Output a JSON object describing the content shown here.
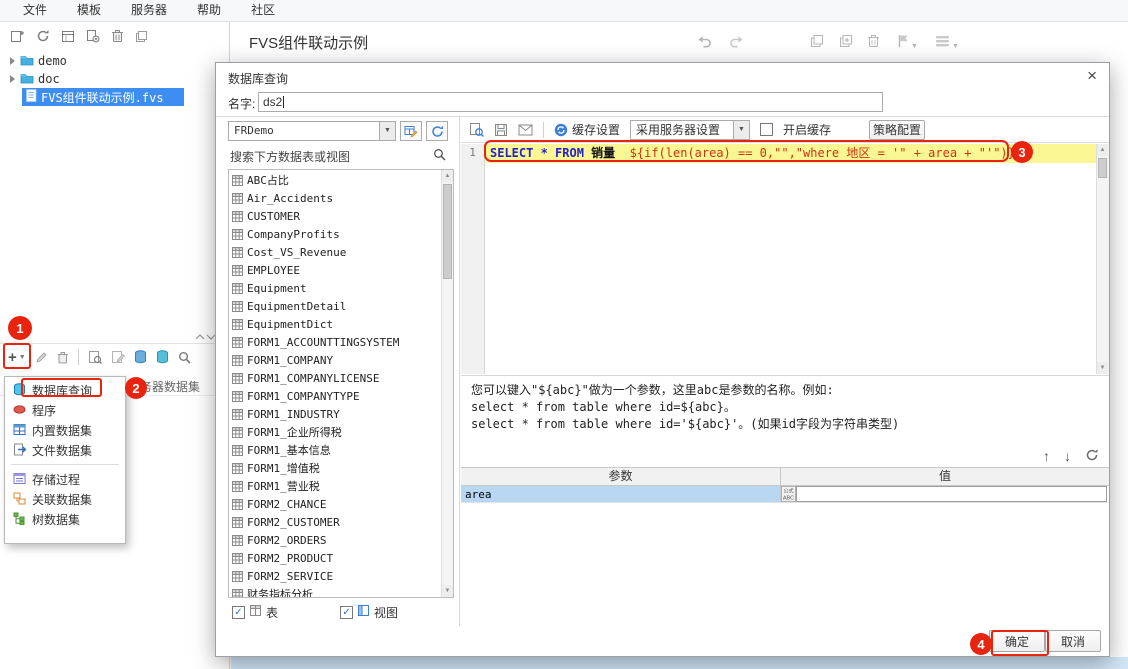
{
  "menubar": {
    "items": [
      "文件",
      "模板",
      "服务器",
      "帮助",
      "社区"
    ]
  },
  "tree": {
    "folders": [
      "demo",
      "doc"
    ],
    "selected_file": "FVS组件联动示例.fvs"
  },
  "doc_header": {
    "title": "FVS组件联动示例"
  },
  "dataset_panel": {
    "server_tab_label": "服务器数据集",
    "menu_group1": [
      {
        "label": "数据库查询",
        "icon": "database"
      },
      {
        "label": "程序",
        "icon": "program"
      },
      {
        "label": "内置数据集",
        "icon": "builtin"
      },
      {
        "label": "文件数据集",
        "icon": "filedataset"
      }
    ],
    "menu_group2": [
      {
        "label": "存储过程",
        "icon": "procedure"
      },
      {
        "label": "关联数据集",
        "icon": "relation"
      },
      {
        "label": "树数据集",
        "icon": "treedataset"
      }
    ]
  },
  "dialog": {
    "title": "数据库查询",
    "name_label": "名字:",
    "name_value": "ds2",
    "connection_value": "FRDemo",
    "search_placeholder": "搜索下方数据表或视图",
    "tables": [
      "ABC占比",
      "Air_Accidents",
      "CUSTOMER",
      "CompanyProfits",
      "Cost_VS_Revenue",
      "EMPLOYEE",
      "Equipment",
      "EquipmentDetail",
      "EquipmentDict",
      "FORM1_ACCOUNTTINGSYSTEM",
      "FORM1_COMPANY",
      "FORM1_COMPANYLICENSE",
      "FORM1_COMPANYTYPE",
      "FORM1_INDUSTRY",
      "FORM1_企业所得税",
      "FORM1_基本信息",
      "FORM1_增值税",
      "FORM1_营业税",
      "FORM2_CHANCE",
      "FORM2_CUSTOMER",
      "FORM2_ORDERS",
      "FORM2_PRODUCT",
      "FORM2_SERVICE",
      "财务指标分析"
    ],
    "table_checkbox_label": "表",
    "view_checkbox_label": "视图",
    "toolbar": {
      "cache_settings_label": "缓存设置",
      "server_setting_value": "采用服务器设置",
      "enable_cache_label": "开启缓存",
      "strategy_config_label": "策略配置"
    },
    "sql": {
      "line_number": "1",
      "segments": [
        {
          "text": "SELECT",
          "color": "#2222cc",
          "bold": true
        },
        {
          "text": " * ",
          "color": "#2222cc",
          "bold": true
        },
        {
          "text": "FROM",
          "color": "#2222cc",
          "bold": true
        },
        {
          "text": " 销量  ",
          "color": "#111111",
          "bold": true
        },
        {
          "text": "${if(len(area) == 0,\"\",\"where 地区 = '\" + area + \"'\")}",
          "color": "#cc3311",
          "bold": false
        }
      ]
    },
    "help_lines": [
      "您可以键入\"${abc}\"做为一个参数，这里abc是参数的名称。例如:",
      "select * from table where id=${abc}。",
      "select * from table where id='${abc}'。(如果id字段为字符串类型)"
    ],
    "params": {
      "headers": [
        "参数",
        "值"
      ],
      "rows": [
        {
          "name": "area",
          "value": ""
        }
      ]
    },
    "ok_label": "确定",
    "cancel_label": "取消"
  },
  "annotations": {
    "step1": "1",
    "step2": "2",
    "step3": "3",
    "step4": "4"
  }
}
